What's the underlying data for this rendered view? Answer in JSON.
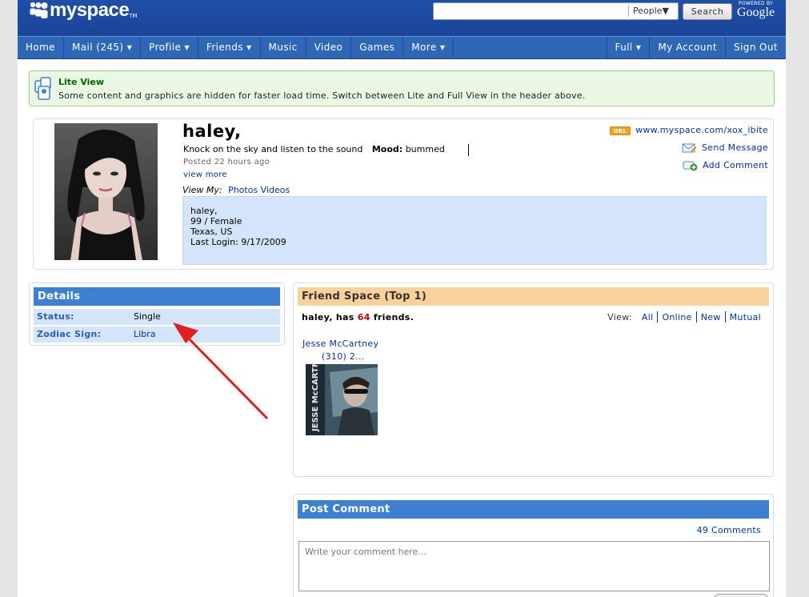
{
  "header": {
    "logo_text": "myspace",
    "logo_tm": "TM",
    "search_placeholder": "",
    "search_scope": "People▼",
    "search_button": "Search",
    "powered_by": "POWERED BY",
    "google": "Google"
  },
  "nav": {
    "left": [
      "Home",
      "Mail (245) ▾",
      "Profile ▾",
      "Friends ▾",
      "Music",
      "Video",
      "Games",
      "More ▾"
    ],
    "right": [
      "Full ▾",
      "My Account",
      "Sign Out"
    ]
  },
  "lite_view": {
    "title": "Lite View",
    "text": "Some content and graphics are hidden for faster load time. Switch between Lite and Full View in the header above."
  },
  "profile": {
    "name": "haley,",
    "headline": "Knock on the sky and listen to the sound",
    "mood_label": "Mood:",
    "mood_value": "bummed",
    "posted": "Posted 22 hours ago",
    "view_more": "view more",
    "view_my_label": "View My:",
    "view_my_photos": "Photos",
    "view_my_videos": "Videos",
    "info": {
      "line1": "haley,",
      "line2": "99 / Female",
      "line3": "Texas, US",
      "line4": "Last Login: 9/17/2009"
    },
    "url_badge": "URL",
    "url": "www.myspace.com/xox_ibite",
    "send_message": "Send Message",
    "add_comment": "Add Comment"
  },
  "details": {
    "title": "Details",
    "rows": [
      {
        "label": "Status:",
        "value": "Single"
      },
      {
        "label": "Zodiac Sign:",
        "value": "Libra"
      }
    ]
  },
  "friend_space": {
    "title": "Friend Space (Top 1)",
    "count_prefix": "haley, has",
    "count": "64",
    "count_suffix": "friends.",
    "view_label": "View:",
    "filters": [
      "All",
      "Online",
      "New",
      "Mutual"
    ],
    "friend_name": "Jesse McCartney",
    "friend_sub": "(310) 2...",
    "album_text": "JESSE McCARTNEY"
  },
  "post_comment": {
    "title": "Post Comment",
    "count": "49 Comments",
    "placeholder": "Write your comment here..."
  },
  "colors": {
    "header_blue": "#1f4fa6",
    "nav_blue": "#2d67b5",
    "section_blue": "#3d7fd1",
    "light_blue": "#d4e5fb",
    "friend_header": "#f8d19b",
    "lite_green_bg": "#eaf7e3",
    "link": "#003399",
    "arrow": "#e02020"
  }
}
